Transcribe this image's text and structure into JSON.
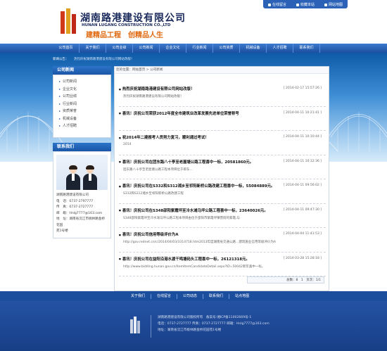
{
  "header": {
    "company_cn": "湖南路港建设有限公司",
    "company_en": "HUNAN LUGANG CONSTRUCTION CO.,LTD",
    "slogan": "建精品工程　创精品人生",
    "toplinks": [
      "在线留言",
      "收藏本站",
      "网站地图"
    ]
  },
  "nav": [
    "公司首页",
    "关于我们",
    "公司业绩",
    "公司新闻",
    "企业文化",
    "行业新闻",
    "公司资质",
    "机械设备",
    "人才招聘",
    "联系我们"
  ],
  "ticker": {
    "label": "新闻公告：",
    "text": "热烈庆祝湖南路港建设有限公司网站改版！"
  },
  "sidebar": {
    "news_title": "公司新闻",
    "menu": [
      "公司新闻",
      "企业文化",
      "公司业绩",
      "行业新闻",
      "资质荣誉",
      "机械设备",
      "人才招聘"
    ],
    "contact_title": "联系我们",
    "contact_lines": [
      "湖南路港建设有限公司",
      "电　话：0737-2797777",
      "传　真：0737-2727777",
      "邮　箱：Hnlg7777@163.com",
      "地　址：湖南省沅江市桃林路金桥花园",
      "苑1号楼"
    ]
  },
  "breadcrumb": "您的位置：网站首页 > 公司新闻",
  "news": [
    {
      "title": "热烈庆祝湖南路港建设有限公司网站改版！",
      "date": "[ 2014-02-17 15:57:26 ]",
      "summary": "热烈庆祝湖南路港建设有限公司网站改版！"
    },
    {
      "title": "喜讯！庆祝公司荣获2012年度全市建筑业改革发展先进单位荣誉称号",
      "date": "[ 2014-04-11 10:21:41 ]",
      "summary": ""
    },
    {
      "title": "祝2014年二建报考人员努力复习，顺利通过考试！",
      "date": "[ 2014-04-11 10:10:44 ]",
      "summary": "2014"
    },
    {
      "title": "喜讯！庆祝公司在团东路八十亭至老屋塘公路工程喜中一标，20581860元。",
      "date": "[ 2014-04-11 10:12:36 ]",
      "summary": "团东路八十亭至老屋塘公路工程本项目位于即东..."
    },
    {
      "title": "喜讯！庆祝公司在S332和S312湘乡至祁阳新桥公路改建工程喜中一标，55084889元。",
      "date": "[ 2014-04-11 09:56:02 ]",
      "summary": "S332和S312湘乡至祁阳新桥公路改建工程"
    },
    {
      "title": "喜讯！庆祝公司在S348邵阳紫霞坪至冷水滩马坪公路工程喜中一标，23640026元。",
      "date": "[ 2014-04-11 09:47:30 ]",
      "summary": "S348邵阳紫霞坪至冷水滩马坪公路工程本项目由位于邵阳市紫霞坪镇营街的紫霞,与"
    },
    {
      "title": "喜讯！庆祝公司信用等级评价为A",
      "date": "[ 2014-04-04 11:41:53 ]",
      "summary": "http://gov.rednet.cn/c/2014/04/03/3314718.htm2013年度湖南省交通公路...建筑施业信用等级评价为A"
    },
    {
      "title": "喜讯！庆祝公司在益阳沿港水渡干鸣塘码头工程喜中一标，26121318元。",
      "date": "[ 2014-03-28 15:28:18 ]",
      "summary": "http://www.bidding.hunan.gov.cn/itemItemCandidateDetail.aspx?ID=50042新年喜中一标。"
    }
  ],
  "pager": "总数：8　1　页次：1/1",
  "footer_nav": [
    "关于我们",
    "在线留言",
    "公司动态",
    "联系我们",
    "站点地图"
  ],
  "footer_lines": [
    "湖南路港建设有限公司版权所有　备案号:湘ICP备11002669号-1",
    "电话：0737-2727777 传真：0737-2727777 邮箱：Hnlg7777@163.com",
    "地址：湖南省沅江市桃林路金桥花园苑1号楼"
  ]
}
